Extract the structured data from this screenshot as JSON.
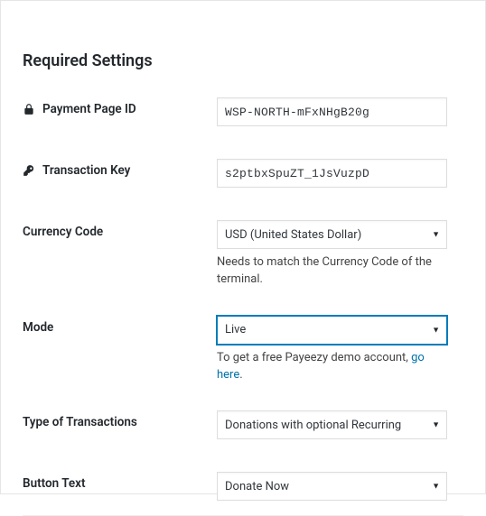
{
  "section_title": "Required Settings",
  "fields": {
    "payment_page_id": {
      "label": "Payment Page ID",
      "value": "WSP-NORTH-mFxNHgB20g"
    },
    "transaction_key": {
      "label": "Transaction Key",
      "value": "s2ptbxSpuZT_1JsVuzpD"
    },
    "currency_code": {
      "label": "Currency Code",
      "selected": "USD (United States Dollar)",
      "help": "Needs to match the Currency Code of the terminal."
    },
    "mode": {
      "label": "Mode",
      "selected": "Live",
      "help_prefix": "To get a free Payeezy demo account, ",
      "help_link_text": "go here",
      "help_suffix": "."
    },
    "type_of_transactions": {
      "label": "Type of Transactions",
      "selected": "Donations with optional Recurring"
    },
    "button_text": {
      "label": "Button Text",
      "selected": "Donate Now"
    }
  }
}
